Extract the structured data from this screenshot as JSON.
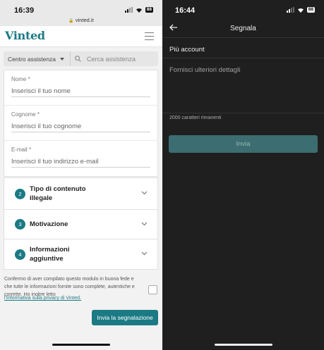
{
  "left": {
    "status": {
      "time": "16:39",
      "url": "vinted.it",
      "battery": "88"
    },
    "header": {
      "logo": "Vinted"
    },
    "search": {
      "category": "Centro assistenza",
      "placeholder": "Cerca assistenza"
    },
    "form": {
      "fields": [
        {
          "label": "Nome *",
          "placeholder": "Inserisci il tuo nome"
        },
        {
          "label": "Cognome *",
          "placeholder": "Inserisci il tuo cognome"
        },
        {
          "label": "E-mail *",
          "placeholder": "Inserisci il tuo indirizzo e-mail"
        }
      ],
      "sections": [
        {
          "number": "2",
          "title": "Tipo di contenuto illegale"
        },
        {
          "number": "3",
          "title": "Motivazione"
        },
        {
          "number": "4",
          "title": "Informazioni aggiuntive"
        }
      ],
      "consent_text": "Confermo di aver compilato questo modulo in buona fede e che tutte le informazioni fornite sono complete, autentiche e corrette. Ho inoltre letto",
      "consent_link": "l'Informativa sulla privacy di Vinted.",
      "submit_label": "Invia la segnalazione"
    }
  },
  "right": {
    "status": {
      "time": "16:44",
      "battery": "88"
    },
    "header": {
      "title": "Segnala"
    },
    "reason": "Più account",
    "details_placeholder": "Fornisci ulteriori dettagli",
    "remaining": "2000 caratteri rimanenti",
    "send_label": "Invia"
  },
  "colors": {
    "brand": "#1b7a84",
    "dark_bg": "#1f1f1f",
    "send_button": "#3c6d70"
  },
  "icons": [
    "lock-icon",
    "menu-icon",
    "search-icon",
    "chevron-down-icon",
    "back-arrow-icon",
    "signal-icon",
    "wifi-icon",
    "battery-icon"
  ]
}
